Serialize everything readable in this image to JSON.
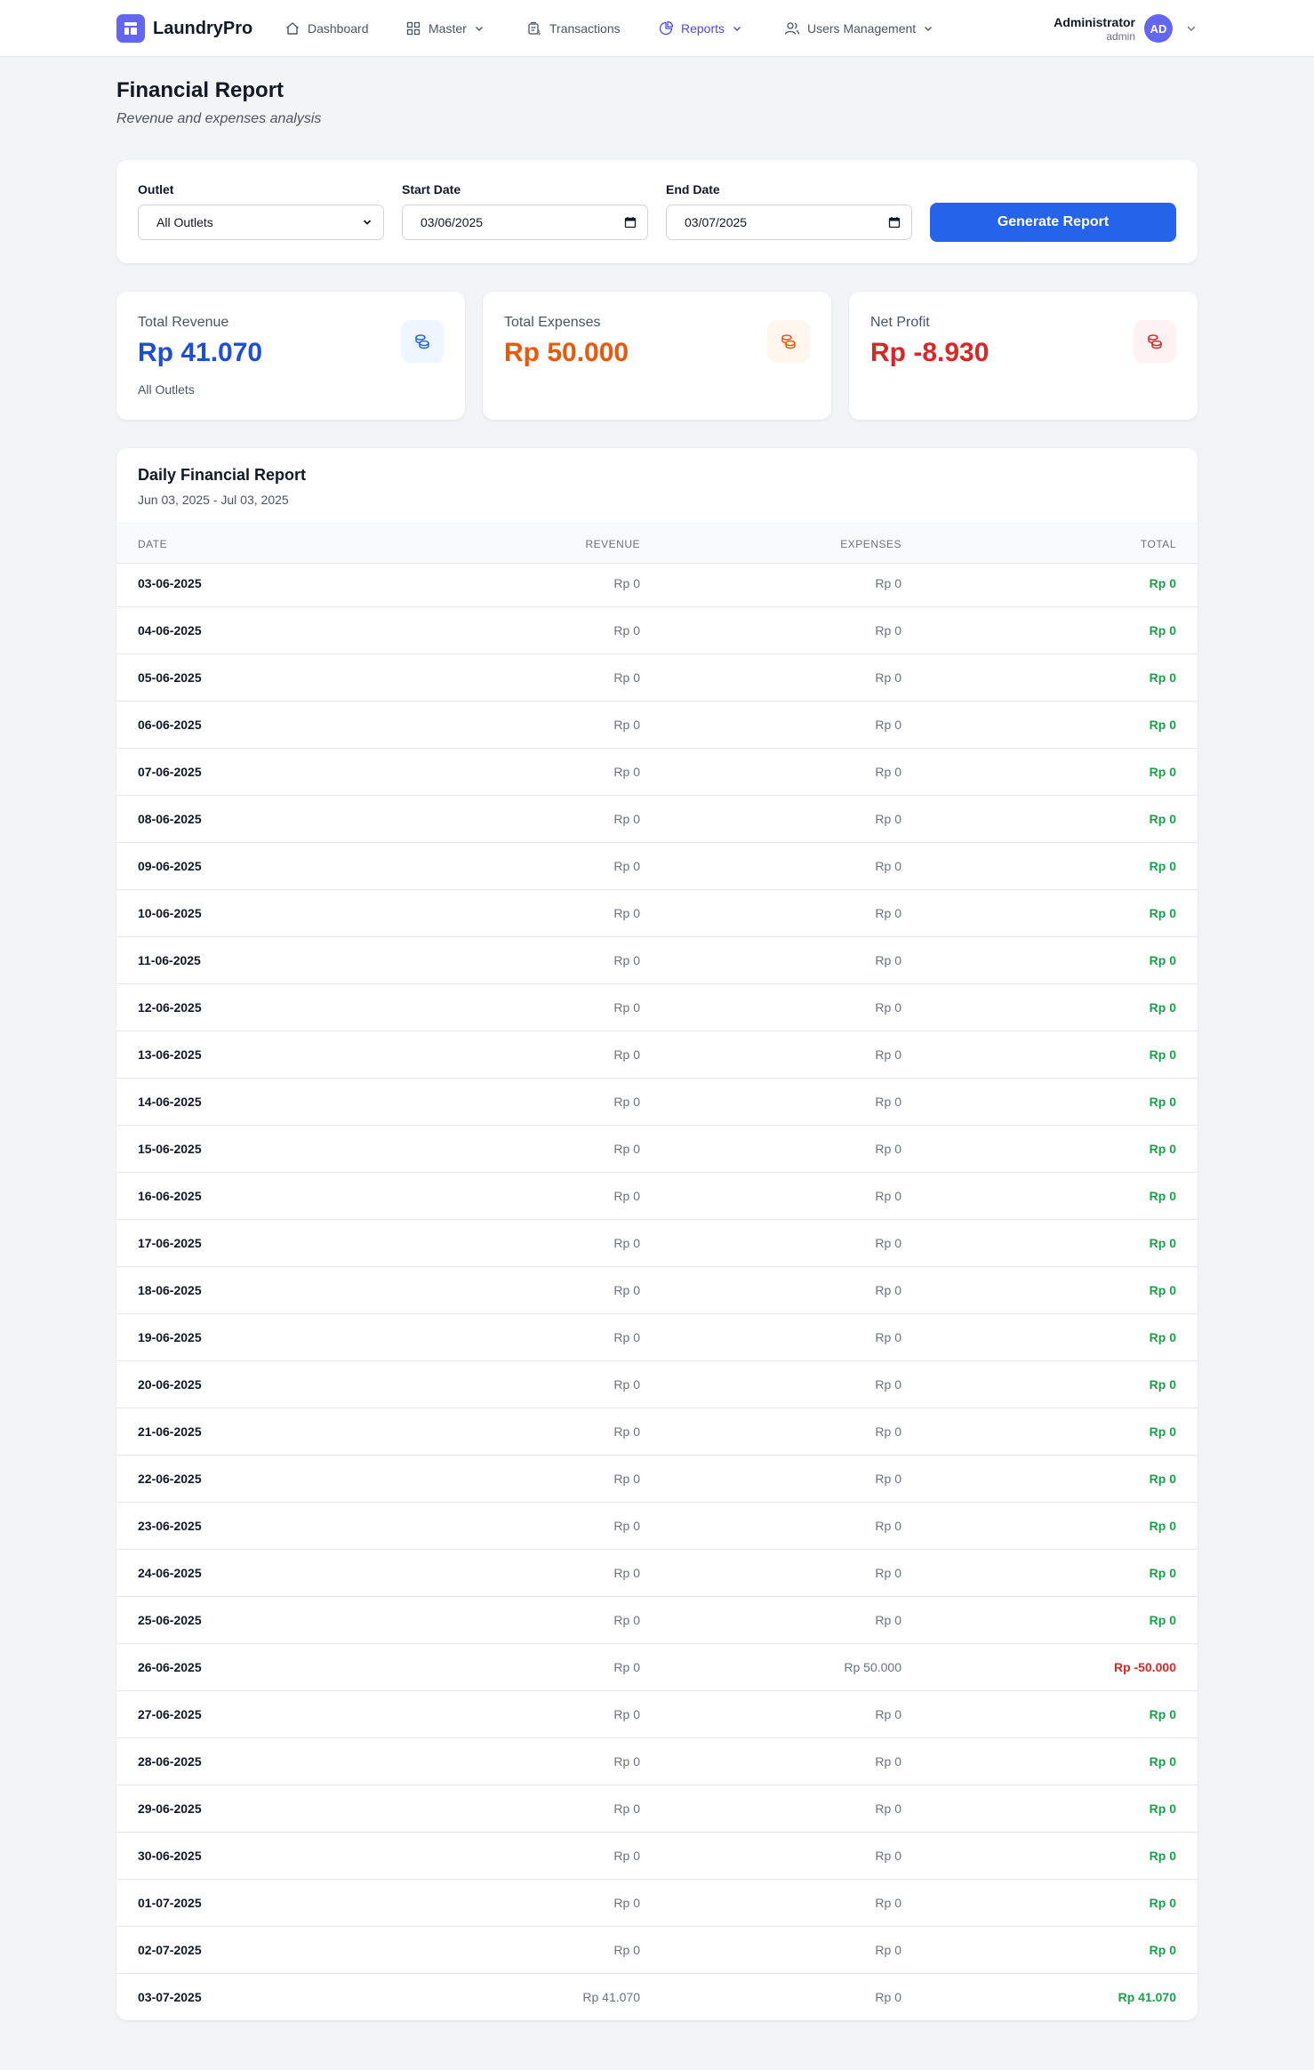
{
  "brand": {
    "name": "LaundryPro"
  },
  "nav": {
    "dashboard": "Dashboard",
    "master": "Master",
    "transactions": "Transactions",
    "reports": "Reports",
    "users": "Users Management"
  },
  "user": {
    "name": "Administrator",
    "role": "admin",
    "initials": "AD"
  },
  "page": {
    "title": "Financial Report",
    "subtitle": "Revenue and expenses analysis"
  },
  "filter": {
    "outlet_label": "Outlet",
    "outlet_value": "All Outlets",
    "start_label": "Start Date",
    "start_value": "03/06/2025",
    "end_label": "End Date",
    "end_value": "03/07/2025",
    "generate_label": "Generate Report"
  },
  "stats": {
    "revenue": {
      "label": "Total Revenue",
      "value": "Rp 41.070",
      "sub": "All Outlets"
    },
    "expenses": {
      "label": "Total Expenses",
      "value": "Rp 50.000"
    },
    "profit": {
      "label": "Net Profit",
      "value": "Rp -8.930"
    }
  },
  "colors": {
    "revenue": "#1d4ed8",
    "expenses": "#ea580c",
    "profit": "#dc2626",
    "positive": "#16a34a",
    "negative": "#dc2626",
    "accent": "#2563eb"
  },
  "table": {
    "title": "Daily Financial Report",
    "range": "Jun 03, 2025 - Jul 03, 2025",
    "headers": {
      "date": "DATE",
      "revenue": "REVENUE",
      "expenses": "EXPENSES",
      "total": "TOTAL"
    },
    "rows": [
      {
        "date": "03-06-2025",
        "revenue": "Rp 0",
        "expenses": "Rp 0",
        "total": "Rp 0",
        "negative": false
      },
      {
        "date": "04-06-2025",
        "revenue": "Rp 0",
        "expenses": "Rp 0",
        "total": "Rp 0",
        "negative": false
      },
      {
        "date": "05-06-2025",
        "revenue": "Rp 0",
        "expenses": "Rp 0",
        "total": "Rp 0",
        "negative": false
      },
      {
        "date": "06-06-2025",
        "revenue": "Rp 0",
        "expenses": "Rp 0",
        "total": "Rp 0",
        "negative": false
      },
      {
        "date": "07-06-2025",
        "revenue": "Rp 0",
        "expenses": "Rp 0",
        "total": "Rp 0",
        "negative": false
      },
      {
        "date": "08-06-2025",
        "revenue": "Rp 0",
        "expenses": "Rp 0",
        "total": "Rp 0",
        "negative": false
      },
      {
        "date": "09-06-2025",
        "revenue": "Rp 0",
        "expenses": "Rp 0",
        "total": "Rp 0",
        "negative": false
      },
      {
        "date": "10-06-2025",
        "revenue": "Rp 0",
        "expenses": "Rp 0",
        "total": "Rp 0",
        "negative": false
      },
      {
        "date": "11-06-2025",
        "revenue": "Rp 0",
        "expenses": "Rp 0",
        "total": "Rp 0",
        "negative": false
      },
      {
        "date": "12-06-2025",
        "revenue": "Rp 0",
        "expenses": "Rp 0",
        "total": "Rp 0",
        "negative": false
      },
      {
        "date": "13-06-2025",
        "revenue": "Rp 0",
        "expenses": "Rp 0",
        "total": "Rp 0",
        "negative": false
      },
      {
        "date": "14-06-2025",
        "revenue": "Rp 0",
        "expenses": "Rp 0",
        "total": "Rp 0",
        "negative": false
      },
      {
        "date": "15-06-2025",
        "revenue": "Rp 0",
        "expenses": "Rp 0",
        "total": "Rp 0",
        "negative": false
      },
      {
        "date": "16-06-2025",
        "revenue": "Rp 0",
        "expenses": "Rp 0",
        "total": "Rp 0",
        "negative": false
      },
      {
        "date": "17-06-2025",
        "revenue": "Rp 0",
        "expenses": "Rp 0",
        "total": "Rp 0",
        "negative": false
      },
      {
        "date": "18-06-2025",
        "revenue": "Rp 0",
        "expenses": "Rp 0",
        "total": "Rp 0",
        "negative": false
      },
      {
        "date": "19-06-2025",
        "revenue": "Rp 0",
        "expenses": "Rp 0",
        "total": "Rp 0",
        "negative": false
      },
      {
        "date": "20-06-2025",
        "revenue": "Rp 0",
        "expenses": "Rp 0",
        "total": "Rp 0",
        "negative": false
      },
      {
        "date": "21-06-2025",
        "revenue": "Rp 0",
        "expenses": "Rp 0",
        "total": "Rp 0",
        "negative": false
      },
      {
        "date": "22-06-2025",
        "revenue": "Rp 0",
        "expenses": "Rp 0",
        "total": "Rp 0",
        "negative": false
      },
      {
        "date": "23-06-2025",
        "revenue": "Rp 0",
        "expenses": "Rp 0",
        "total": "Rp 0",
        "negative": false
      },
      {
        "date": "24-06-2025",
        "revenue": "Rp 0",
        "expenses": "Rp 0",
        "total": "Rp 0",
        "negative": false
      },
      {
        "date": "25-06-2025",
        "revenue": "Rp 0",
        "expenses": "Rp 0",
        "total": "Rp 0",
        "negative": false
      },
      {
        "date": "26-06-2025",
        "revenue": "Rp 0",
        "expenses": "Rp 50.000",
        "total": "Rp -50.000",
        "negative": true
      },
      {
        "date": "27-06-2025",
        "revenue": "Rp 0",
        "expenses": "Rp 0",
        "total": "Rp 0",
        "negative": false
      },
      {
        "date": "28-06-2025",
        "revenue": "Rp 0",
        "expenses": "Rp 0",
        "total": "Rp 0",
        "negative": false
      },
      {
        "date": "29-06-2025",
        "revenue": "Rp 0",
        "expenses": "Rp 0",
        "total": "Rp 0",
        "negative": false
      },
      {
        "date": "30-06-2025",
        "revenue": "Rp 0",
        "expenses": "Rp 0",
        "total": "Rp 0",
        "negative": false
      },
      {
        "date": "01-07-2025",
        "revenue": "Rp 0",
        "expenses": "Rp 0",
        "total": "Rp 0",
        "negative": false
      },
      {
        "date": "02-07-2025",
        "revenue": "Rp 0",
        "expenses": "Rp 0",
        "total": "Rp 0",
        "negative": false
      },
      {
        "date": "03-07-2025",
        "revenue": "Rp 41.070",
        "expenses": "Rp 0",
        "total": "Rp 41.070",
        "negative": false
      }
    ]
  }
}
